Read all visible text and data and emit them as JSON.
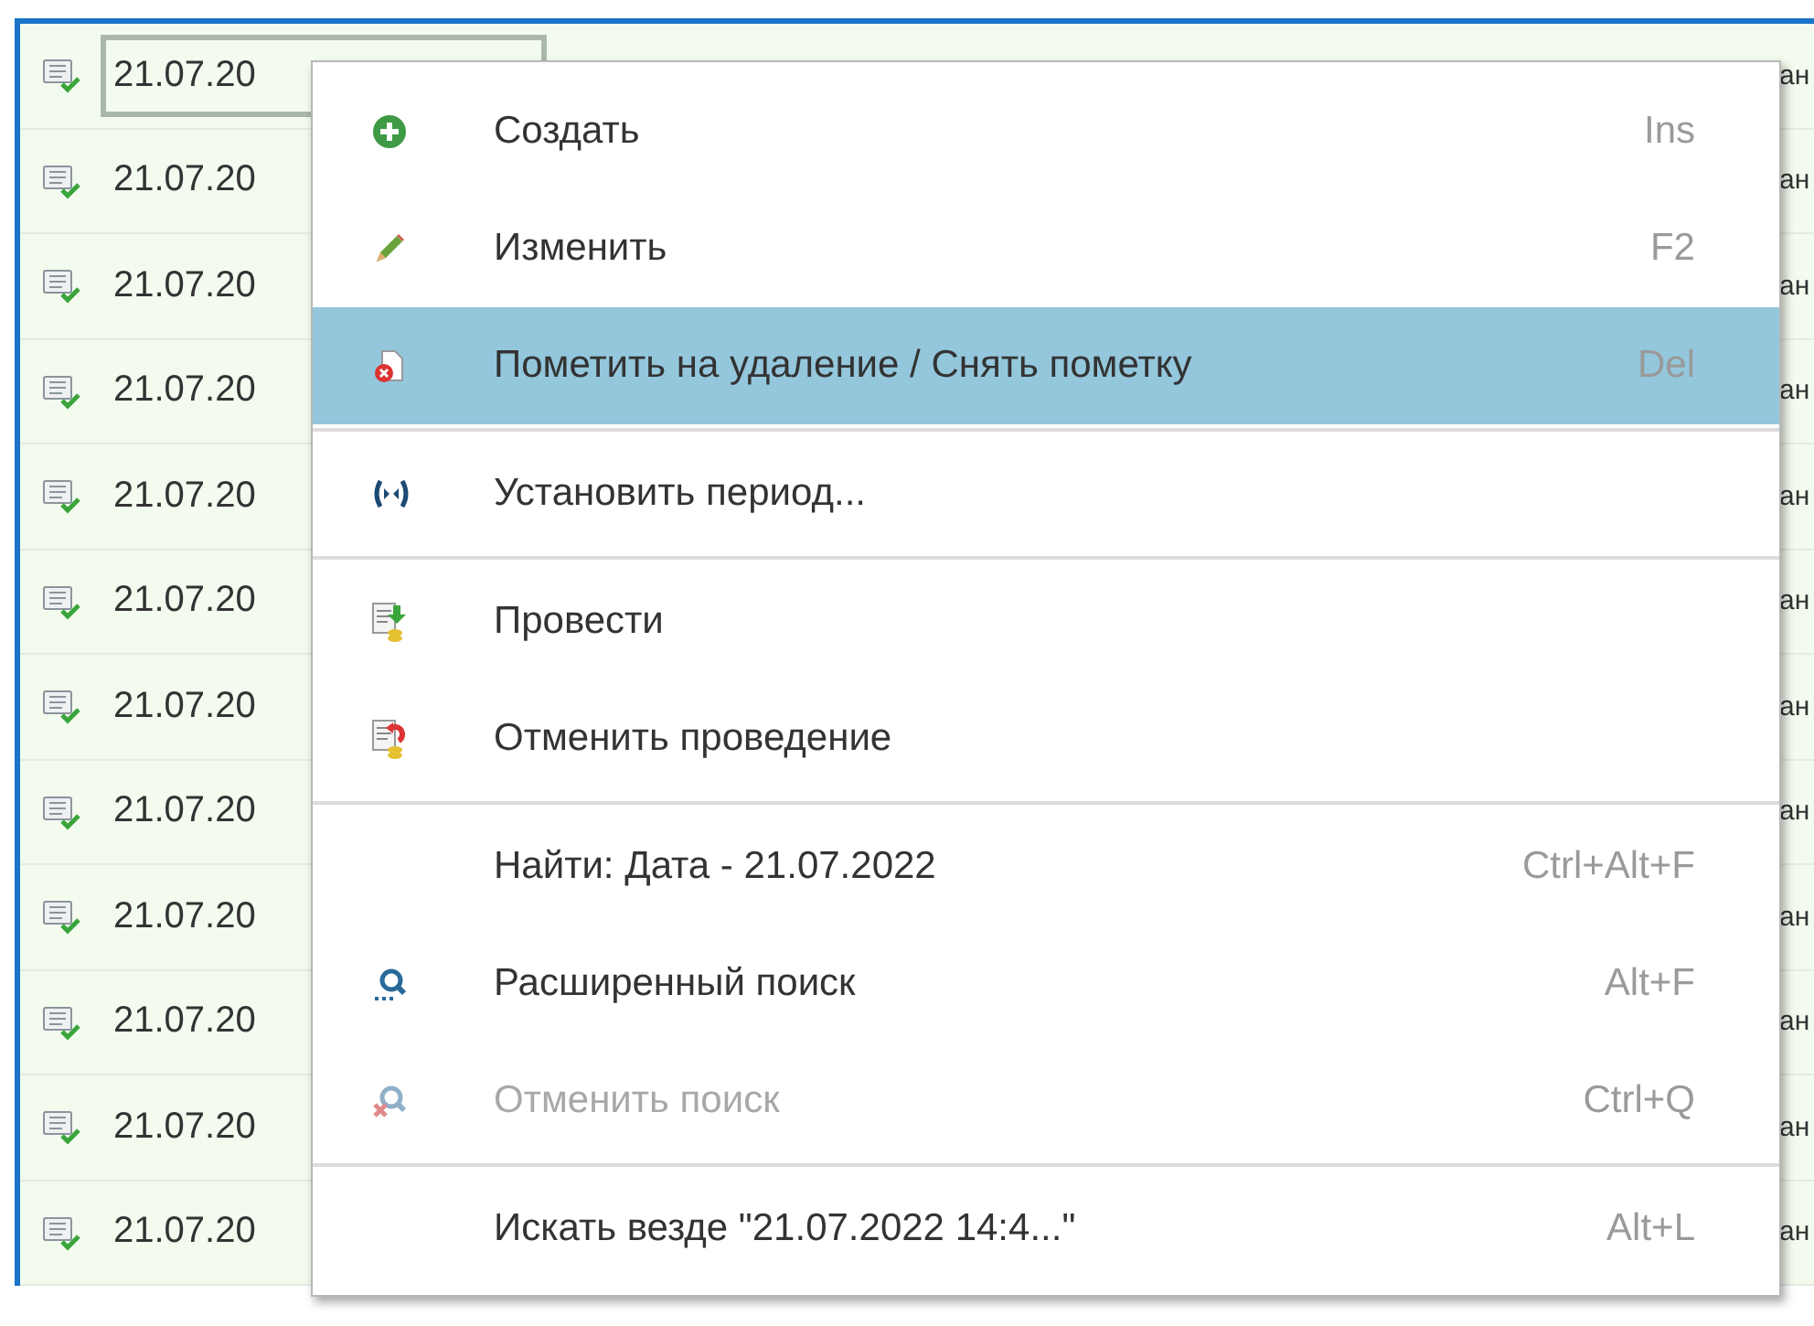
{
  "table": {
    "rows": [
      {
        "date": "21.07.20",
        "column_2": "ан",
        "focused": true
      },
      {
        "date": "21.07.20",
        "column_2": "ан",
        "focused": false
      },
      {
        "date": "21.07.20",
        "column_2": "ан",
        "focused": false
      },
      {
        "date": "21.07.20",
        "column_2": "ан",
        "focused": false
      },
      {
        "date": "21.07.20",
        "column_2": "ан",
        "focused": false
      },
      {
        "date": "21.07.20",
        "column_2": "ан",
        "focused": false
      },
      {
        "date": "21.07.20",
        "column_2": "ан",
        "focused": false
      },
      {
        "date": "21.07.20",
        "column_2": "ан",
        "focused": false
      },
      {
        "date": "21.07.20",
        "column_2": "ан",
        "focused": false
      },
      {
        "date": "21.07.20",
        "column_2": "ан",
        "focused": false
      },
      {
        "date": "21.07.20",
        "column_2": "ан",
        "focused": false
      },
      {
        "date": "21.07.20",
        "column_2": "ан",
        "focused": false
      }
    ]
  },
  "context_menu": {
    "groups": [
      [
        {
          "kind": "plus",
          "label": "Создать",
          "shortcut": "Ins",
          "selected": false,
          "disabled": false
        },
        {
          "kind": "pencil",
          "label": "Изменить",
          "shortcut": "F2",
          "selected": false,
          "disabled": false
        },
        {
          "kind": "delete",
          "label": "Пометить на удаление / Снять пометку",
          "shortcut": "Del",
          "selected": true,
          "disabled": false
        }
      ],
      [
        {
          "kind": "period",
          "label": "Установить период...",
          "selected": false,
          "disabled": false
        }
      ],
      [
        {
          "kind": "post",
          "label": "Провести",
          "selected": false,
          "disabled": false
        },
        {
          "kind": "unpost",
          "label": "Отменить проведение",
          "selected": false,
          "disabled": false
        }
      ],
      [
        {
          "kind": "plain",
          "label": "Найти: Дата - 21.07.2022",
          "shortcut": "Ctrl+Alt+F",
          "selected": false,
          "disabled": false
        },
        {
          "kind": "search",
          "label": "Расширенный поиск",
          "shortcut": "Alt+F",
          "selected": false,
          "disabled": false
        },
        {
          "kind": "cancel-search",
          "label": "Отменить поиск",
          "shortcut": "Ctrl+Q",
          "selected": false,
          "disabled": true
        }
      ],
      [
        {
          "kind": "plain",
          "label": "Искать везде \"21.07.2022 14:4...\"",
          "shortcut": "Alt+L",
          "selected": false,
          "disabled": false
        }
      ]
    ]
  }
}
